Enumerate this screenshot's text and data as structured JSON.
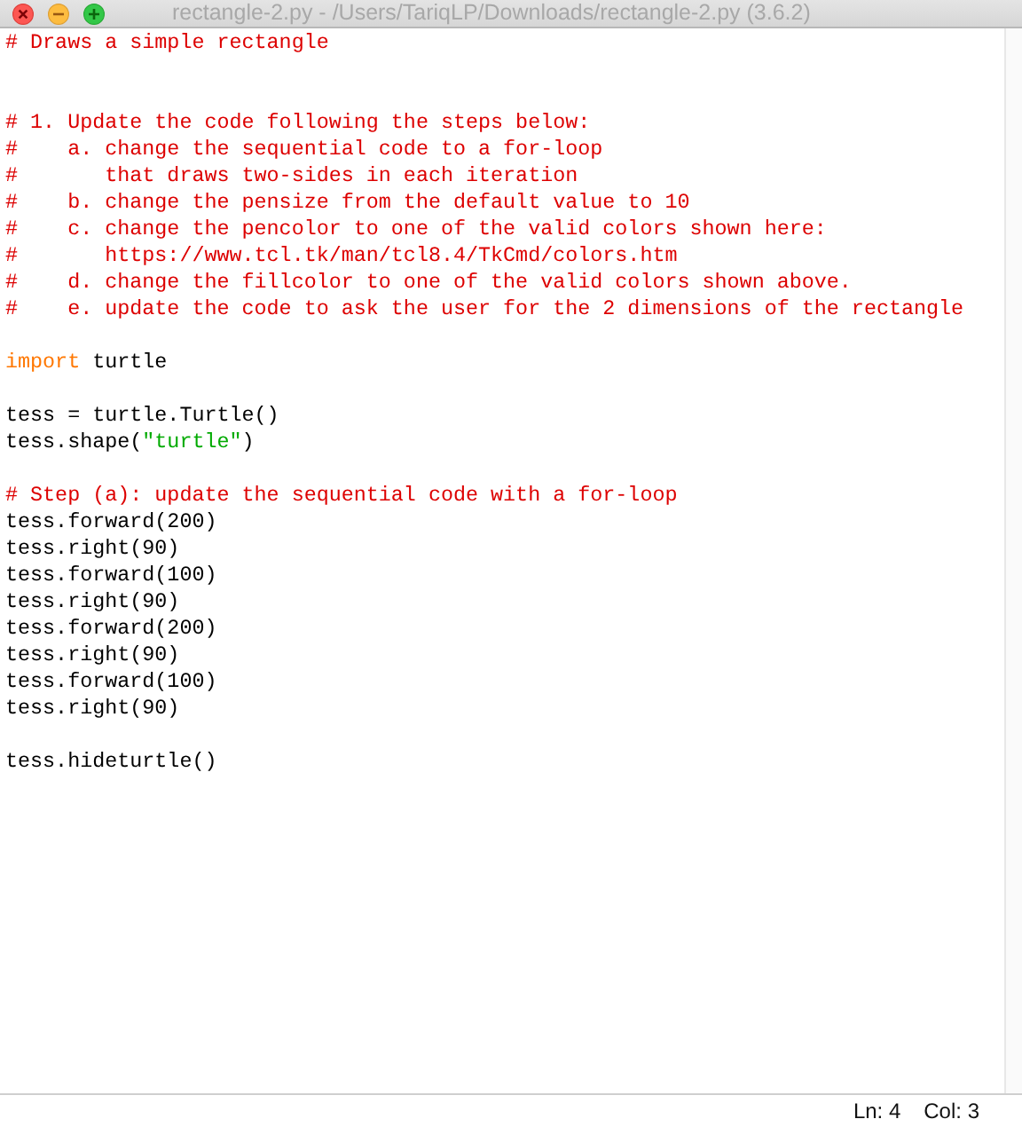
{
  "window": {
    "title": "rectangle-2.py - /Users/TariqLP/Downloads/rectangle-2.py (3.6.2)"
  },
  "editor": {
    "lines": [
      {
        "kind": "code",
        "tokens": [
          {
            "kind": "comment",
            "text": "# Draws a simple rectangle"
          }
        ]
      },
      {
        "kind": "blank"
      },
      {
        "kind": "blank"
      },
      {
        "kind": "code",
        "tokens": [
          {
            "kind": "comment",
            "text": "# 1. Update the code following the steps below:"
          }
        ]
      },
      {
        "kind": "code",
        "tokens": [
          {
            "kind": "comment",
            "text": "#    a. change the sequential code to a for-loop"
          }
        ]
      },
      {
        "kind": "code",
        "tokens": [
          {
            "kind": "comment",
            "text": "#       that draws two-sides in each iteration"
          }
        ]
      },
      {
        "kind": "code",
        "tokens": [
          {
            "kind": "comment",
            "text": "#    b. change the pensize from the default value to 10"
          }
        ]
      },
      {
        "kind": "code",
        "tokens": [
          {
            "kind": "comment",
            "text": "#    c. change the pencolor to one of the valid colors shown here:"
          }
        ]
      },
      {
        "kind": "code",
        "tokens": [
          {
            "kind": "comment",
            "text": "#       https://www.tcl.tk/man/tcl8.4/TkCmd/colors.htm"
          }
        ]
      },
      {
        "kind": "code",
        "tokens": [
          {
            "kind": "comment",
            "text": "#    d. change the fillcolor to one of the valid colors shown above."
          }
        ]
      },
      {
        "kind": "code",
        "tokens": [
          {
            "kind": "comment",
            "text": "#    e. update the code to ask the user for the 2 dimensions of the rectangle"
          }
        ]
      },
      {
        "kind": "blank"
      },
      {
        "kind": "code",
        "tokens": [
          {
            "kind": "keyword",
            "text": "import"
          },
          {
            "kind": "plain",
            "text": " turtle"
          }
        ]
      },
      {
        "kind": "blank"
      },
      {
        "kind": "code",
        "tokens": [
          {
            "kind": "plain",
            "text": "tess = turtle.Turtle()"
          }
        ]
      },
      {
        "kind": "code",
        "tokens": [
          {
            "kind": "plain",
            "text": "tess.shape("
          },
          {
            "kind": "string",
            "text": "\"turtle\""
          },
          {
            "kind": "plain",
            "text": ")"
          }
        ]
      },
      {
        "kind": "blank"
      },
      {
        "kind": "code",
        "tokens": [
          {
            "kind": "comment",
            "text": "# Step (a): update the sequential code with a for-loop"
          }
        ]
      },
      {
        "kind": "code",
        "tokens": [
          {
            "kind": "plain",
            "text": "tess.forward(200)"
          }
        ]
      },
      {
        "kind": "code",
        "tokens": [
          {
            "kind": "plain",
            "text": "tess.right(90)"
          }
        ]
      },
      {
        "kind": "code",
        "tokens": [
          {
            "kind": "plain",
            "text": "tess.forward(100)"
          }
        ]
      },
      {
        "kind": "code",
        "tokens": [
          {
            "kind": "plain",
            "text": "tess.right(90)"
          }
        ]
      },
      {
        "kind": "code",
        "tokens": [
          {
            "kind": "plain",
            "text": "tess.forward(200)"
          }
        ]
      },
      {
        "kind": "code",
        "tokens": [
          {
            "kind": "plain",
            "text": "tess.right(90)"
          }
        ]
      },
      {
        "kind": "code",
        "tokens": [
          {
            "kind": "plain",
            "text": "tess.forward(100)"
          }
        ]
      },
      {
        "kind": "code",
        "tokens": [
          {
            "kind": "plain",
            "text": "tess.right(90)"
          }
        ]
      },
      {
        "kind": "blank"
      },
      {
        "kind": "code",
        "tokens": [
          {
            "kind": "plain",
            "text": "tess.hideturtle()"
          }
        ]
      }
    ]
  },
  "status_bar": {
    "line": "Ln: 4",
    "column": "Col: 3"
  }
}
